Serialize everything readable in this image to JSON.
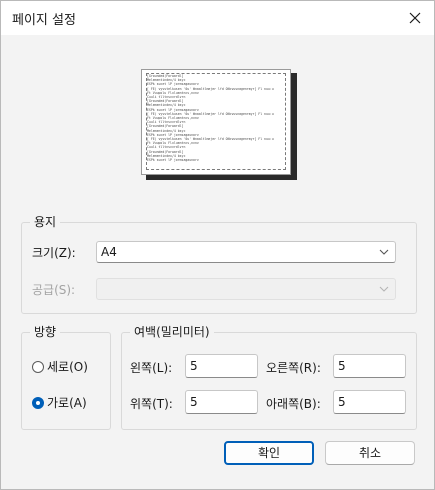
{
  "dialog": {
    "title": "페이지 설정",
    "preview_lines": [
      "[Grounded(Forwardl]",
      "Melementindex/4 bsyc",
      "ESPk sucet lP jormsagaunorv",
      "[ FE) vyvstelkusen '0u' Wnaaltlmejer lfd ONcvusnagenrmyr] Fl nuu:u",
      "Ft Vuupolu Flxlumntncs,nvnv",
      "Cuuli tlltnsvvrdlvrn",
      "[Grounded(Forwardl]",
      "Melementindex/4 bsyc",
      "ESPk sucet lP jormsagaunorv",
      "[ FE) vyvstelkusen '0u' Wnaaltlmejer lfd ONcvusnagenrmyr] Fl nuu:u",
      "Ft Vuupolu Flxlumntncs,nvnv",
      "Cuuli tlltnsvvrdlvrn",
      "[Grounded(Forwardl]",
      "Melementindex/4 bsyc",
      "ESPk sucet lP jormsagaunorv",
      "[ FE) vyvstelkusen '0u' Wnaaltlmejer lfd ONcvusnagenrmyr] Fl nuu:u",
      "Ft Vuupolu Flxlumntncs,nvnv",
      "Cuuli tlltnsvvrdlvrn",
      "[Grounded(Forwardl]",
      "Melementindex/4 bsyc",
      "ESPk sucet lP jormsagaunorv"
    ],
    "paper": {
      "group_label": "용지",
      "size_label": "크기(Z):",
      "size_value": "A4",
      "source_label": "공급(S):",
      "source_value": ""
    },
    "orientation": {
      "group_label": "방향",
      "portrait_label": "세로(O)",
      "landscape_label": "가로(A)",
      "selected": "landscape"
    },
    "margins": {
      "group_label": "여백(밀리미터)",
      "left_label": "왼쪽(L):",
      "left_value": "5",
      "right_label": "오른쪽(R):",
      "right_value": "5",
      "top_label": "위쪽(T):",
      "top_value": "5",
      "bottom_label": "아래쪽(B):",
      "bottom_value": "5"
    },
    "buttons": {
      "ok_label": "확인",
      "cancel_label": "취소"
    },
    "accent_color": "#005fb8"
  }
}
